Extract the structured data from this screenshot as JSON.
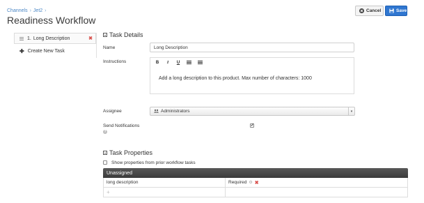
{
  "breadcrumb": {
    "items": [
      "Channels",
      "Jet2"
    ]
  },
  "page_title": "Readiness Workflow",
  "buttons": {
    "cancel_label": "Cancel",
    "save_label": "Save"
  },
  "sidebar": {
    "tasks": [
      {
        "number": "1.",
        "label": "Long Description"
      }
    ],
    "create_label": "Create New Task"
  },
  "task_details": {
    "heading": "Task Details",
    "name_label": "Name",
    "name_value": "Long Description",
    "instructions_label": "Instructions",
    "toolbar": {
      "bold": "B",
      "italic": "I",
      "underline": "U"
    },
    "instructions_text": "Add a long description to this product. Max number of characters: 1000",
    "assignee_label": "Assignee",
    "assignee_value": "Administrators",
    "notifications_label": "Send Notifications",
    "notifications_checked": true,
    "help_symbol": "?"
  },
  "task_properties": {
    "heading": "Task Properties",
    "show_prior_label": "Show properties from prior workflow tasks",
    "show_prior_checked": false,
    "table_heading": "Unassigned",
    "rows": [
      {
        "property": "long description",
        "status": "Required"
      }
    ]
  },
  "colors": {
    "primary": "#2f76d0",
    "danger": "#d9534f",
    "link": "#4a86c5",
    "table_header": "#444444"
  },
  "icons": {
    "cancel": "times-circle-icon",
    "save": "floppy-icon",
    "drag": "drag-handle-icon",
    "remove": "close-icon",
    "add": "plus-icon",
    "users": "users-icon",
    "settings": "gear-icon",
    "help": "question-icon"
  }
}
